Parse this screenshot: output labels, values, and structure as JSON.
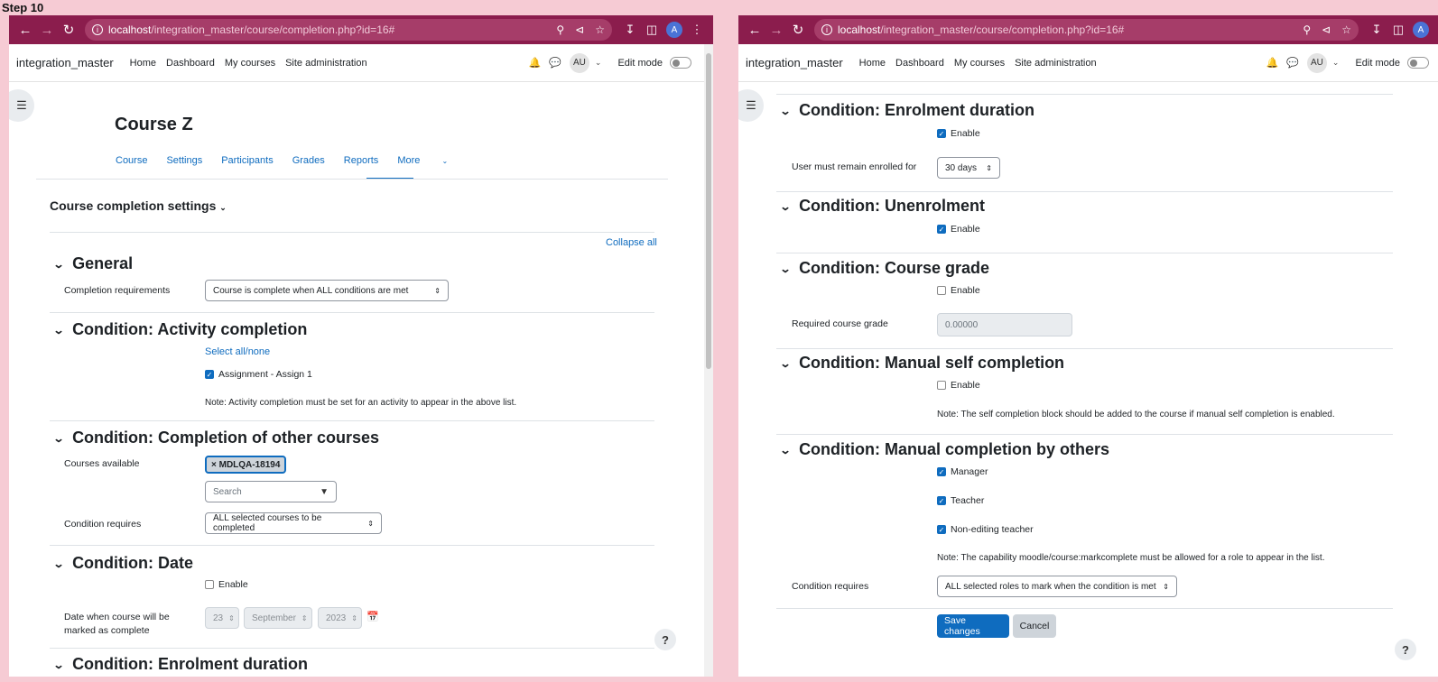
{
  "step_label": "Step 10",
  "browser": {
    "url_host": "localhost",
    "url_path": "/integration_master/course/completion.php?id=16#",
    "profile_initial": "A"
  },
  "navbar": {
    "brand": "integration_master",
    "links": [
      "Home",
      "Dashboard",
      "My courses",
      "Site administration"
    ],
    "user_initials": "AU",
    "edit_mode_label": "Edit mode"
  },
  "course": {
    "title": "Course Z",
    "tabs": [
      "Course",
      "Settings",
      "Participants",
      "Grades",
      "Reports",
      "More"
    ]
  },
  "settings": {
    "title": "Course completion settings",
    "collapse_all": "Collapse all"
  },
  "general": {
    "heading": "General",
    "completion_requirements_label": "Completion requirements",
    "completion_requirements_value": "Course is complete when ALL conditions are met"
  },
  "activity": {
    "heading": "Condition: Activity completion",
    "select_all": "Select all/none",
    "item": "Assignment - Assign 1",
    "note": "Note: Activity completion must be set for an activity to appear in the above list."
  },
  "other_courses": {
    "heading": "Condition: Completion of other courses",
    "available_label": "Courses available",
    "tag": "× MDLQA-18194",
    "search_placeholder": "Search",
    "requires_label": "Condition requires",
    "requires_value": "ALL selected courses to be completed"
  },
  "date": {
    "heading": "Condition: Date",
    "enable": "Enable",
    "label": "Date when course will be marked as complete",
    "day": "23",
    "month": "September",
    "year": "2023"
  },
  "enrolment_duration": {
    "heading": "Condition: Enrolment duration",
    "enable": "Enable",
    "label": "User must remain enrolled for",
    "value": "30 days"
  },
  "unenrolment": {
    "heading": "Condition: Unenrolment",
    "enable": "Enable"
  },
  "course_grade": {
    "heading": "Condition: Course grade",
    "enable": "Enable",
    "label": "Required course grade",
    "value": "0.00000"
  },
  "self_completion": {
    "heading": "Condition: Manual self completion",
    "enable": "Enable",
    "note": "Note: The self completion block should be added to the course if manual self completion is enabled."
  },
  "by_others": {
    "heading": "Condition: Manual completion by others",
    "roles": [
      "Manager",
      "Teacher",
      "Non-editing teacher"
    ],
    "note": "Note: The capability moodle/course:markcomplete must be allowed for a role to appear in the list.",
    "requires_label": "Condition requires",
    "requires_value": "ALL selected roles to mark when the condition is met"
  },
  "buttons": {
    "save": "Save changes",
    "cancel": "Cancel",
    "help": "?"
  }
}
